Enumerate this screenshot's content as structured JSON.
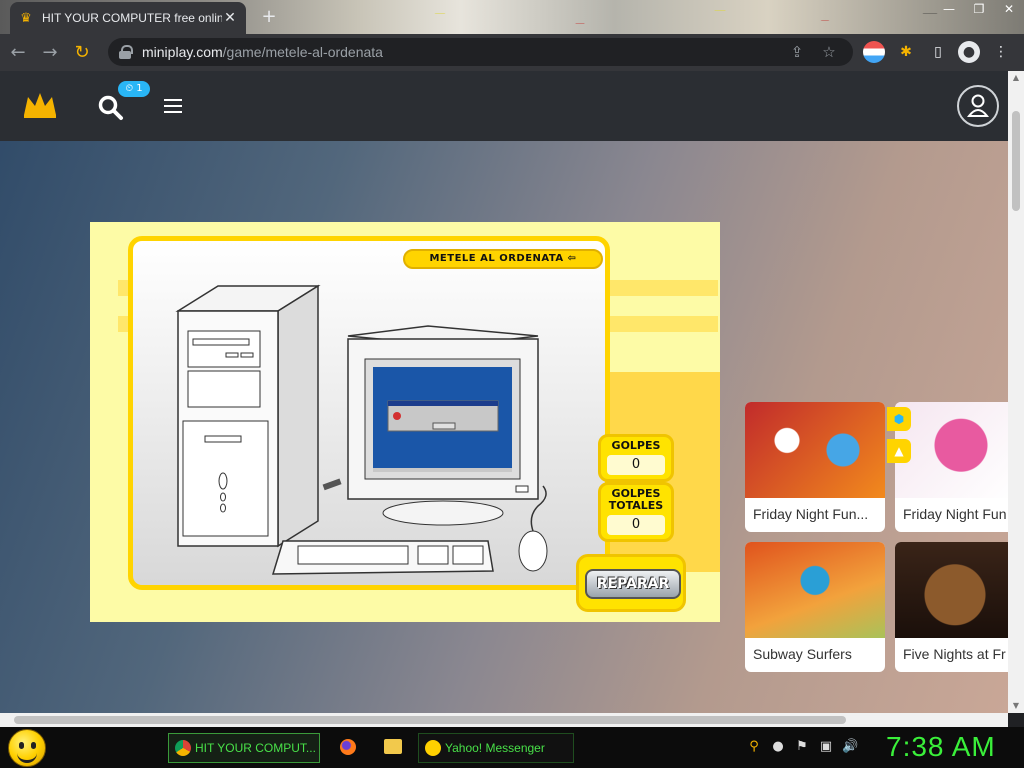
{
  "browser": {
    "tab": {
      "title": "HIT YOUR COMPUTER free onlin",
      "favicon": "crown-icon"
    },
    "new_tab": "+",
    "window_controls": {
      "minimize": "—",
      "restore": "❐",
      "close": "✕"
    },
    "nav": {
      "back": "←",
      "forward": "→",
      "reload": "↻"
    },
    "address": {
      "domain": "miniplay.com",
      "path": "/game/metele-al-ordenata"
    }
  },
  "site": {
    "badge": "⏲ 1",
    "icons": [
      "crown-icon",
      "search-icon",
      "menu-icon",
      "user-icon"
    ]
  },
  "game": {
    "title": "METELE AL ORDENATA ⇦",
    "golpes_label": "GOLPES",
    "golpes_value": "0",
    "totales_label": "GOLPES TOTALES",
    "totales_value": "0",
    "repair_label": "REPARAR"
  },
  "cards": [
    {
      "title": "Friday Night Fun...",
      "color_a": "#c12b2b",
      "color_b": "#f28a1d"
    },
    {
      "title": "Friday Night Fun",
      "color_a": "#e85aa0",
      "color_b": "#ffffff"
    },
    {
      "title": "Subway Surfers",
      "color_a": "#e0531d",
      "color_b": "#2a9fd6"
    },
    {
      "title": "Five Nights at Fr",
      "color_a": "#3a2418",
      "color_b": "#8c5a2c"
    }
  ],
  "taskbar": {
    "tasks": [
      {
        "label": "HIT YOUR COMPUT...",
        "icon": "chrome-icon"
      },
      {
        "label": "Yahoo! Messenger",
        "icon": "yahoo-smiley-icon"
      }
    ],
    "clock": "7:38 AM"
  }
}
